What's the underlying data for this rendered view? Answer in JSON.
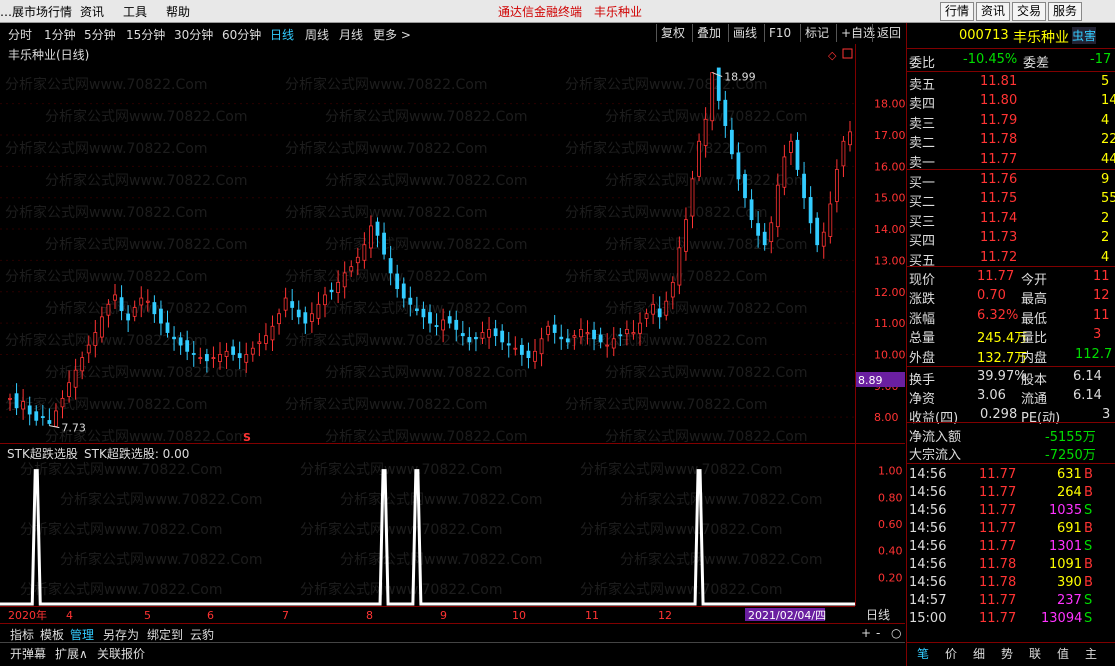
{
  "menubar": {
    "left_items": [
      "…展市场行情",
      "资讯",
      "工具",
      "帮助"
    ],
    "center_title": "通达信金融终端",
    "center_stock": "丰乐种业",
    "right_buttons": [
      "行情",
      "资讯",
      "交易",
      "服务"
    ]
  },
  "toolbar": {
    "periods": [
      "分时",
      "1分钟",
      "5分钟",
      "15分钟",
      "30分钟",
      "60分钟",
      "日线",
      "周线",
      "月线",
      "更多 >"
    ],
    "active_period": "日线",
    "tools": [
      "复权",
      "叠加",
      "画线",
      "F10",
      "标记",
      "+自选",
      "返回"
    ]
  },
  "main_chart": {
    "title": "丰乐种业(日线)",
    "high_label": "18.99",
    "low_label": "7.73",
    "current_price_tag": "8.89",
    "signal_marker": "S",
    "watermark": "分析家公式网www.70822.Com"
  },
  "sub_chart": {
    "title": "STK超跌选股",
    "value_label": "STK超跌选股: 0.00"
  },
  "x_axis": {
    "labels": [
      "2020年",
      "4",
      "5",
      "6",
      "7",
      "8",
      "9",
      "10",
      "11",
      "12"
    ],
    "cursor_date": "2021/02/04/四",
    "period_label": "日线"
  },
  "chart_data": [
    {
      "type": "candlestick",
      "title": "丰乐种业(日线)",
      "y_ticks": [
        "18.00",
        "17.00",
        "16.00",
        "15.00",
        "14.00",
        "13.00",
        "12.00",
        "11.00",
        "10.00",
        "9.00",
        "8.00"
      ],
      "ylim": [
        7.4,
        19.2
      ],
      "x_labels": [
        "2020年",
        "4",
        "5",
        "6",
        "7",
        "8",
        "9",
        "10",
        "11",
        "12"
      ],
      "close_series": [
        8.6,
        8.3,
        8.5,
        8.1,
        7.9,
        8.0,
        7.8,
        8.2,
        8.6,
        9.1,
        9.5,
        9.9,
        10.3,
        10.7,
        11.2,
        11.6,
        11.9,
        11.4,
        11.1,
        11.5,
        11.8,
        11.7,
        11.3,
        11.0,
        10.7,
        10.5,
        10.3,
        10.1,
        10.0,
        9.9,
        9.8,
        9.9,
        10.0,
        10.1,
        10.0,
        9.9,
        10.0,
        10.2,
        10.4,
        10.6,
        10.9,
        11.3,
        11.8,
        11.5,
        11.2,
        11.0,
        11.3,
        11.6,
        11.9,
        12.0,
        12.3,
        12.6,
        12.8,
        13.1,
        13.5,
        14.1,
        13.8,
        13.2,
        12.6,
        12.1,
        11.8,
        11.6,
        11.4,
        11.2,
        11.0,
        10.9,
        11.1,
        11.0,
        10.8,
        10.6,
        10.4,
        10.5,
        10.7,
        10.8,
        10.6,
        10.4,
        10.3,
        10.2,
        10.0,
        9.9,
        10.1,
        10.5,
        10.9,
        10.7,
        10.5,
        10.4,
        10.6,
        10.8,
        10.7,
        10.5,
        10.4,
        10.3,
        10.5,
        10.6,
        10.8,
        10.7,
        11.0,
        11.3,
        11.6,
        11.2,
        11.7,
        12.3,
        13.4,
        14.3,
        15.6,
        16.8,
        17.5,
        18.99,
        18.1,
        17.3,
        16.4,
        15.6,
        15.0,
        14.3,
        13.8,
        13.5,
        14.2,
        15.4,
        16.3,
        16.8,
        15.9,
        15.0,
        14.2,
        13.5,
        13.9,
        14.8,
        15.9,
        16.8,
        17.1
      ],
      "high": 18.99,
      "low": 7.73
    },
    {
      "type": "line",
      "title": "STK超跌选股",
      "y_ticks": [
        "1.00",
        "0.80",
        "0.60",
        "0.40",
        "0.20"
      ],
      "ylim": [
        0,
        1.05
      ],
      "signal_positions": [
        4,
        57,
        62,
        105
      ],
      "value": 0.0
    }
  ],
  "quote": {
    "code": "000713",
    "name": "丰乐种业",
    "badge": "虫害",
    "weibi_label": "委比",
    "weibi_value": "-10.45%",
    "weicha_label": "委差",
    "weicha_value": "-17",
    "asks": [
      {
        "label": "卖五",
        "price": "11.81",
        "vol": "5"
      },
      {
        "label": "卖四",
        "price": "11.80",
        "vol": "14"
      },
      {
        "label": "卖三",
        "price": "11.79",
        "vol": "4"
      },
      {
        "label": "卖二",
        "price": "11.78",
        "vol": "22"
      },
      {
        "label": "卖一",
        "price": "11.77",
        "vol": "44"
      }
    ],
    "bids": [
      {
        "label": "买一",
        "price": "11.76",
        "vol": "9"
      },
      {
        "label": "买二",
        "price": "11.75",
        "vol": "55"
      },
      {
        "label": "买三",
        "price": "11.74",
        "vol": "2"
      },
      {
        "label": "买四",
        "price": "11.73",
        "vol": "2"
      },
      {
        "label": "买五",
        "price": "11.72",
        "vol": "4"
      }
    ],
    "stats": [
      {
        "l1": "现价",
        "v1": "11.77",
        "l2": "今开",
        "v2": "11"
      },
      {
        "l1": "涨跌",
        "v1": "0.70",
        "l2": "最高",
        "v2": "12"
      },
      {
        "l1": "涨幅",
        "v1": "6.32%",
        "l2": "最低",
        "v2": "11"
      },
      {
        "l1": "总量",
        "v1": "245.4万",
        "l2": "量比",
        "v2": "3"
      },
      {
        "l1": "外盘",
        "v1": "132.7万",
        "l2": "内盘",
        "v2": "112.7"
      }
    ],
    "stats2": [
      {
        "l1": "换手",
        "v1": "39.97%",
        "l2": "股本",
        "v2": "6.14"
      },
      {
        "l1": "净资",
        "v1": "3.06",
        "l2": "流通",
        "v2": "6.14"
      },
      {
        "l1": "收益(四)",
        "v1": "0.298",
        "l2": "PE(动)",
        "v2": "3"
      }
    ],
    "netflow_label": "净流入额",
    "netflow_value": "-5155万",
    "block_label": "大宗流入",
    "block_value": "-7250万"
  },
  "ticks": [
    {
      "time": "14:56",
      "price": "11.77",
      "vol": "631",
      "side": "B"
    },
    {
      "time": "14:56",
      "price": "11.77",
      "vol": "264",
      "side": "B"
    },
    {
      "time": "14:56",
      "price": "11.77",
      "vol": "1035",
      "side": "S"
    },
    {
      "time": "14:56",
      "price": "11.77",
      "vol": "691",
      "side": "B"
    },
    {
      "time": "14:56",
      "price": "11.77",
      "vol": "1301",
      "side": "S"
    },
    {
      "time": "14:56",
      "price": "11.78",
      "vol": "1091",
      "side": "B"
    },
    {
      "time": "14:56",
      "price": "11.78",
      "vol": "390",
      "side": "B"
    },
    {
      "time": "14:57",
      "price": "11.77",
      "vol": "237",
      "side": "S"
    },
    {
      "time": "15:00",
      "price": "11.77",
      "vol": "13094",
      "side": "S"
    }
  ],
  "bottom_tabs": [
    "指标",
    "模板",
    "管理",
    "另存为",
    "绑定到",
    "云豹"
  ],
  "bottom_tabs_active": "管理",
  "bottom_tabs2": [
    "开弹幕",
    "扩展∧",
    "关联报价"
  ],
  "zoom_controls": [
    "+",
    "-",
    "○"
  ],
  "right_tabs": [
    "笔",
    "价",
    "细",
    "势",
    "联",
    "值",
    "主"
  ],
  "colors": {
    "up": "#ff3333",
    "down": "#33ccff",
    "frame": "#800000",
    "text": "#dddddd"
  }
}
